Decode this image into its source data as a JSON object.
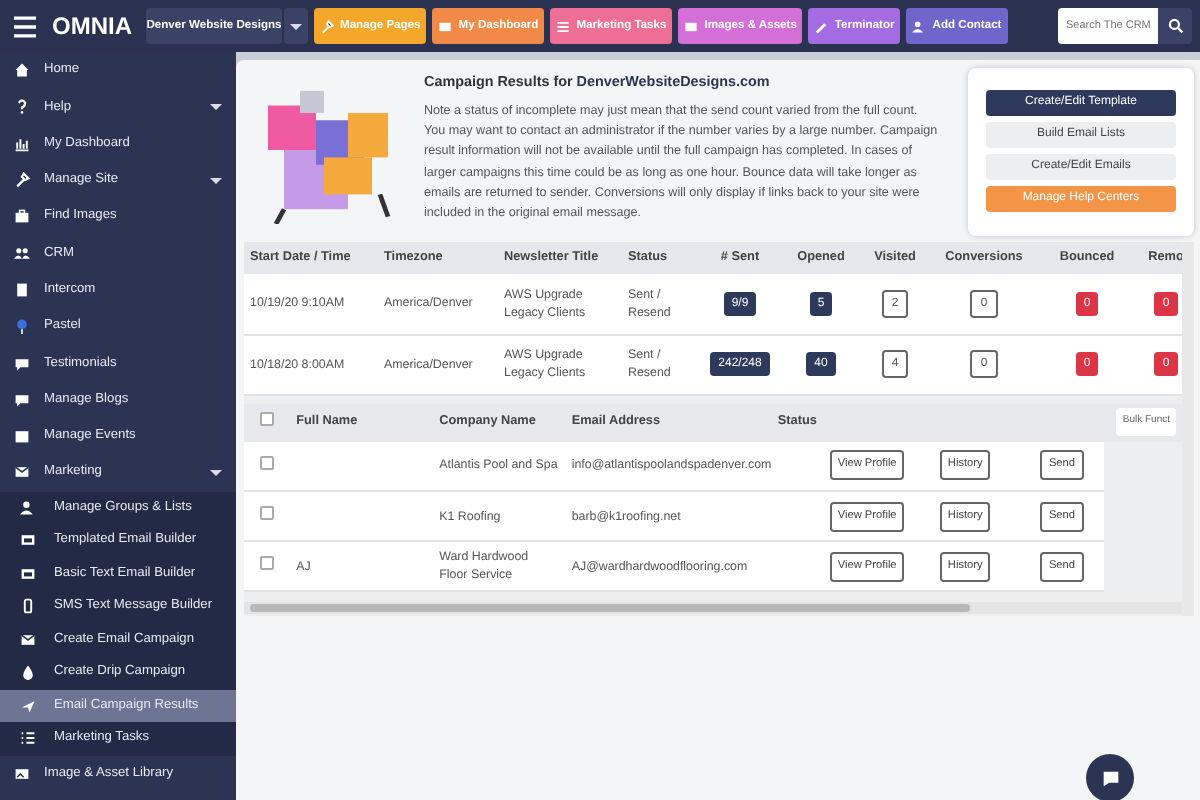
{
  "topbar": {
    "logo": "OMNIA",
    "site_selector": "Denver Website Designs",
    "buttons": [
      {
        "label": "Manage Pages",
        "color": "#f5a72c"
      },
      {
        "label": "My Dashboard",
        "color": "#f08a46"
      },
      {
        "label": "Marketing Tasks",
        "color": "#ee6f95"
      },
      {
        "label": "Images & Assets",
        "color": "#d46fd8"
      },
      {
        "label": "Terminator",
        "color": "#a56be3"
      },
      {
        "label": "Add Contact",
        "color": "#6f66cc"
      }
    ],
    "search": {
      "placeholder": "Search The CRM"
    }
  },
  "sidebar": {
    "items": [
      {
        "label": "Home",
        "submenu": false
      },
      {
        "label": "Help",
        "submenu": true
      },
      {
        "label": "My Dashboard",
        "submenu": false
      },
      {
        "label": "Manage Site",
        "submenu": true
      },
      {
        "label": "Find Images",
        "submenu": false
      },
      {
        "label": "CRM",
        "submenu": false
      },
      {
        "label": "Intercom",
        "submenu": false
      },
      {
        "label": "Pastel",
        "submenu": false
      },
      {
        "label": "Testimonials",
        "submenu": false
      },
      {
        "label": "Manage Blogs",
        "submenu": false
      },
      {
        "label": "Manage Events",
        "submenu": false
      },
      {
        "label": "Marketing",
        "submenu": true,
        "children": [
          {
            "label": "Manage Groups & Lists",
            "selected": false
          },
          {
            "label": "Templated Email Builder",
            "selected": false
          },
          {
            "label": "Basic Text Email Builder",
            "selected": false
          },
          {
            "label": "SMS Text Message Builder",
            "selected": false
          },
          {
            "label": "Create Email Campaign",
            "selected": false
          },
          {
            "label": "Create Drip Campaign",
            "selected": false
          },
          {
            "label": "Email Campaign Results",
            "selected": true
          },
          {
            "label": "Marketing Tasks",
            "selected": false
          }
        ]
      },
      {
        "label": "Image & Asset Library",
        "submenu": false
      }
    ]
  },
  "intro": {
    "title": "Campaign Results for **DenverWebsiteDesigns.com**",
    "note": "Note a status of incomplete may just mean that the send count varied from the full count. You may want to contact an administrator if the number varies by a large number. Campaign result information will not be available until the full campaign has completed. In cases of larger campaigns this time could be as long as one hour. Bounce data will take longer as emails are returned to sender. Conversions will only display if links back to your site were included in the original email message."
  },
  "actions": [
    {
      "label": "Create/Edit Template",
      "kind": "dark"
    },
    {
      "label": "Build Email Lists",
      "kind": "light"
    },
    {
      "label": "Create/Edit Emails",
      "kind": "light"
    },
    {
      "label": "Manage Help Centers",
      "kind": "orange"
    }
  ],
  "campaigns": {
    "columns": [
      "Start Date / Time",
      "Timezone",
      "Newsletter Title",
      "Status",
      "# Sent",
      "Opened",
      "Visited",
      "Conversions",
      "Bounced",
      "Remo"
    ],
    "rows": [
      {
        "start": "10/19/20 9:10AM",
        "timezone": "America/Denver",
        "title": "AWS Upgrade Legacy Clients",
        "status": "Sent / Resend",
        "sent": "9/9",
        "opened": "5",
        "visited": "2",
        "conversions": "0",
        "bounced": "0",
        "removed": "0"
      },
      {
        "start": "10/18/20 8:00AM",
        "timezone": "America/Denver",
        "title": "AWS Upgrade Legacy Clients",
        "status": "Sent / Resend",
        "sent": "242/248",
        "opened": "40",
        "visited": "4",
        "conversions": "0",
        "bounced": "0",
        "removed": "0"
      }
    ]
  },
  "recipients": {
    "all_checked": false,
    "columns": [
      "Full Name",
      "Company Name",
      "Email Address",
      "Status"
    ],
    "bulk_button": "Bulk Funct",
    "rows": [
      {
        "checked": false,
        "company": "Atlantis Pool and Spa",
        "email": "info@atlantispoolandspadenver.com",
        "buttons": [
          "View Profile",
          "History",
          "Send"
        ]
      },
      {
        "checked": false,
        "company": "K1 Roofing",
        "email": "barb@k1roofing.net",
        "buttons": [
          "View Profile",
          "History",
          "Send"
        ]
      },
      {
        "checked": false,
        "name": "AJ",
        "company": "Ward Hardwood Floor Service",
        "email": "AJ@wardhardwoodflooring.com",
        "buttons": [
          "View Profile",
          "History",
          "Send"
        ]
      }
    ]
  }
}
